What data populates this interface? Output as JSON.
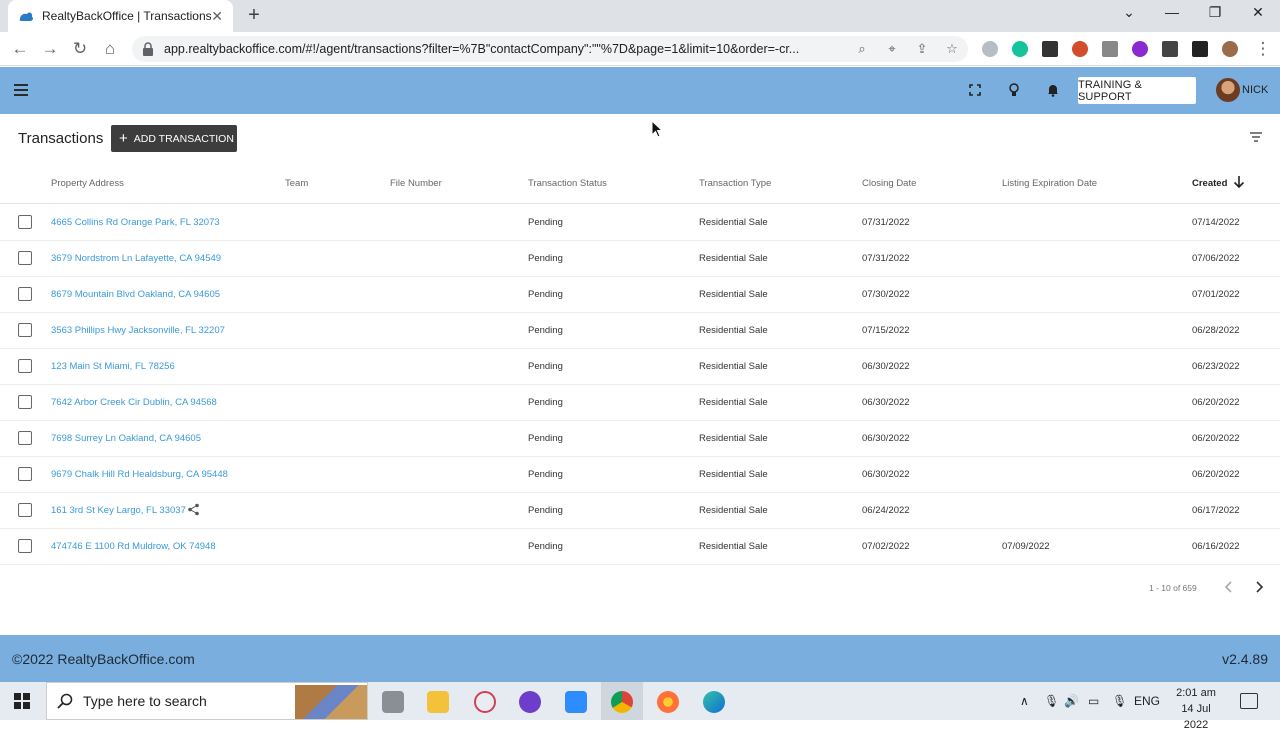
{
  "browser": {
    "tab_title": "RealtyBackOffice | Transactions",
    "url": "app.realtybackoffice.com/#!/agent/transactions?filter=%7B\"contactCompany\":\"\"%7D&page=1&limit=10&order=-cr..."
  },
  "header": {
    "support_label": "TRAINING & SUPPORT",
    "user_name": "NICK"
  },
  "page": {
    "title": "Transactions",
    "add_label": "ADD TRANSACTION"
  },
  "table": {
    "columns": {
      "address": "Property Address",
      "team": "Team",
      "file_number": "File Number",
      "status": "Transaction Status",
      "type": "Transaction Type",
      "closing": "Closing Date",
      "listing_exp": "Listing Expiration Date",
      "created": "Created"
    },
    "rows": [
      {
        "address": "4665 Collins Rd Orange Park, FL 32073",
        "team": "",
        "file_number": "",
        "status": "Pending",
        "type": "Residential Sale",
        "closing": "07/31/2022",
        "listing_exp": "",
        "created": "07/14/2022"
      },
      {
        "address": "3679 Nordstrom Ln Lafayette, CA 94549",
        "team": "",
        "file_number": "",
        "status": "Pending",
        "type": "Residential Sale",
        "closing": "07/31/2022",
        "listing_exp": "",
        "created": "07/06/2022"
      },
      {
        "address": "8679 Mountain Blvd Oakland, CA 94605",
        "team": "",
        "file_number": "",
        "status": "Pending",
        "type": "Residential Sale",
        "closing": "07/30/2022",
        "listing_exp": "",
        "created": "07/01/2022"
      },
      {
        "address": "3563 Phillips Hwy Jacksonville, FL 32207",
        "team": "",
        "file_number": "",
        "status": "Pending",
        "type": "Residential Sale",
        "closing": "07/15/2022",
        "listing_exp": "",
        "created": "06/28/2022"
      },
      {
        "address": "123 Main St Miami, FL 78256",
        "team": "",
        "file_number": "",
        "status": "Pending",
        "type": "Residential Sale",
        "closing": "06/30/2022",
        "listing_exp": "",
        "created": "06/23/2022"
      },
      {
        "address": "7642 Arbor Creek Cir Dublin, CA 94568",
        "team": "",
        "file_number": "",
        "status": "Pending",
        "type": "Residential Sale",
        "closing": "06/30/2022",
        "listing_exp": "",
        "created": "06/20/2022"
      },
      {
        "address": "7698 Surrey Ln Oakland, CA 94605",
        "team": "",
        "file_number": "",
        "status": "Pending",
        "type": "Residential Sale",
        "closing": "06/30/2022",
        "listing_exp": "",
        "created": "06/20/2022"
      },
      {
        "address": "9679 Chalk Hill Rd Healdsburg, CA 95448",
        "team": "",
        "file_number": "",
        "status": "Pending",
        "type": "Residential Sale",
        "closing": "06/30/2022",
        "listing_exp": "",
        "created": "06/20/2022"
      },
      {
        "address": "161 3rd St Key Largo, FL 33037",
        "team": "",
        "file_number": "",
        "status": "Pending",
        "type": "Residential Sale",
        "closing": "06/24/2022",
        "listing_exp": "",
        "created": "06/17/2022"
      },
      {
        "address": "474746 E 1100 Rd Muldrow, OK 74948",
        "team": "",
        "file_number": "",
        "status": "Pending",
        "type": "Residential Sale",
        "closing": "07/02/2022",
        "listing_exp": "07/09/2022",
        "created": "06/16/2022"
      }
    ]
  },
  "pagination": {
    "label": "1 - 10 of 659"
  },
  "footer": {
    "copyright": "©2022 RealtyBackOffice.com",
    "version": "v2.4.89"
  },
  "taskbar": {
    "search_placeholder": "Type here to search",
    "lang": "ENG",
    "time": "2:01 am",
    "date": "14 Jul 2022"
  },
  "colors": {
    "header_bg": "#79aede",
    "link": "#3a9ad9",
    "add_button_bg": "#3d3d3d"
  }
}
